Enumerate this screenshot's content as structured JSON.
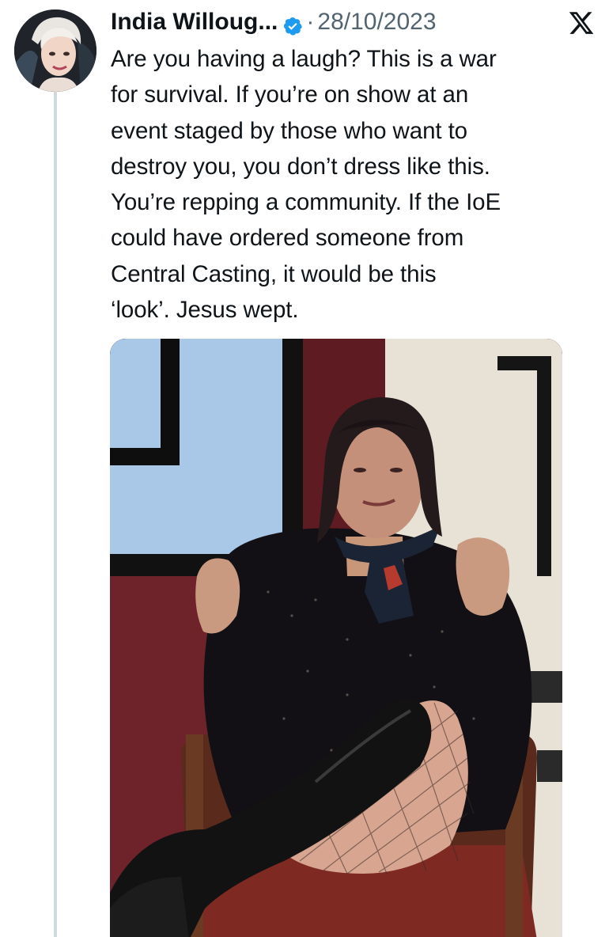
{
  "tweet": {
    "author_name": "India Willoug...",
    "separator": "·",
    "timestamp": "28/10/2023",
    "body_lines": [
      "Are you having a laugh? This is a war",
      "for survival. If you’re on show at an",
      "event staged by those who want to",
      "destroy you, you don’t dress like this.",
      "You’re repping a community. If the IoE",
      "could have ordered someone from",
      "Central Casting, it would be this",
      "‘look’. Jesus wept."
    ]
  },
  "icons": {
    "avatar": "profile-photo",
    "verified": "verified-badge-icon",
    "platform": "x-logo-icon"
  },
  "colors": {
    "text": "#0f1419",
    "secondary": "#536471",
    "verified_blue": "#1d9bf0",
    "thread_line": "#cfd9de"
  }
}
